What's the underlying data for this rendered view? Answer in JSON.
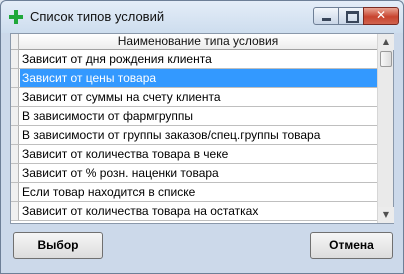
{
  "window": {
    "title": "Список типов условий",
    "icon": "green-cross-icon",
    "close_glyph": "✕"
  },
  "table": {
    "column_header": "Наименование типа условия",
    "rows": [
      "Зависит от дня рождения клиента",
      "Зависит от цены товара",
      "Зависит от суммы на счету клиента",
      "В зависимости от фармгруппы",
      "В зависимости от группы заказов/спец.группы товара",
      "Зависит от количества товара в чеке",
      "Зависит от % розн. наценки товара",
      "Если товар находится в списке",
      "Зависит от количества товара на остатках"
    ],
    "selected_index": 1
  },
  "scrollbar": {
    "up_glyph": "▲",
    "down_glyph": "▼"
  },
  "buttons": {
    "ok": "Выбор",
    "cancel": "Отмена"
  },
  "colors": {
    "selection": "#3399ff",
    "close_button": "#c8442f"
  }
}
